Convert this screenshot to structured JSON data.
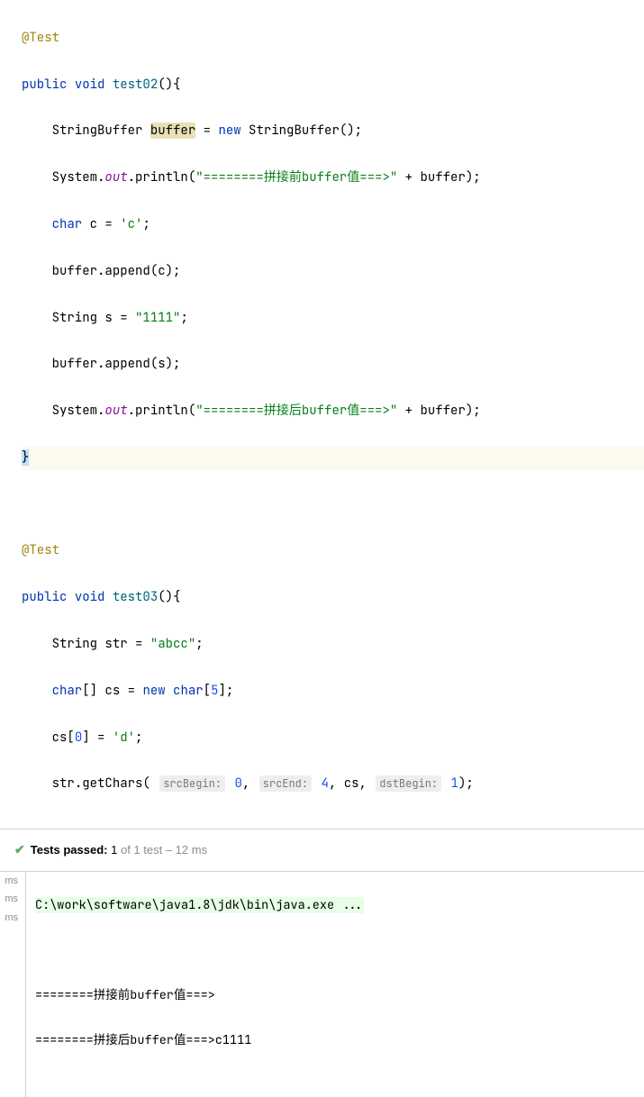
{
  "code": {
    "annotation": "@Test",
    "public": "public",
    "void": "void",
    "m_test02": "test02",
    "cls_StringBuffer": "StringBuffer",
    "var_buffer": "buffer",
    "new": "new",
    "cls_System": "System",
    "field_out": "out",
    "m_println": "println",
    "str_before": "\"========拼接前buffer值===>\"",
    "plus": " + ",
    "char_kw": "char",
    "var_c": "c",
    "char_lit_c": "'c'",
    "m_append": "append",
    "cls_String": "String",
    "var_s": "s",
    "str_1111": "\"1111\"",
    "str_after": "\"========拼接后buffer值===>\"",
    "m_test03": "test03",
    "var_str": "str",
    "str_abcc": "\"abcc\"",
    "char_arr": "char",
    "var_cs": "cs",
    "arr_size": "5",
    "idx0": "0",
    "char_lit_d": "'d'",
    "m_getChars": "getChars",
    "hint_srcBegin": "srcBegin:",
    "val_srcBegin": "0",
    "hint_srcEnd": "srcEnd:",
    "val_srcEnd": "4",
    "hint_dstBegin": "dstBegin:",
    "val_dstBegin": "1"
  },
  "test_status": {
    "passed_label": "Tests passed:",
    "passed_count": "1",
    "of_text": "of 1 test",
    "duration": "– 12 ms"
  },
  "console": {
    "gutter_label": "ms",
    "cmd": "C:\\work\\software\\java1.8\\jdk\\bin\\java.exe ...",
    "out1": "========拼接前buffer值===>",
    "out2": "========拼接后buffer值===>c1111"
  }
}
